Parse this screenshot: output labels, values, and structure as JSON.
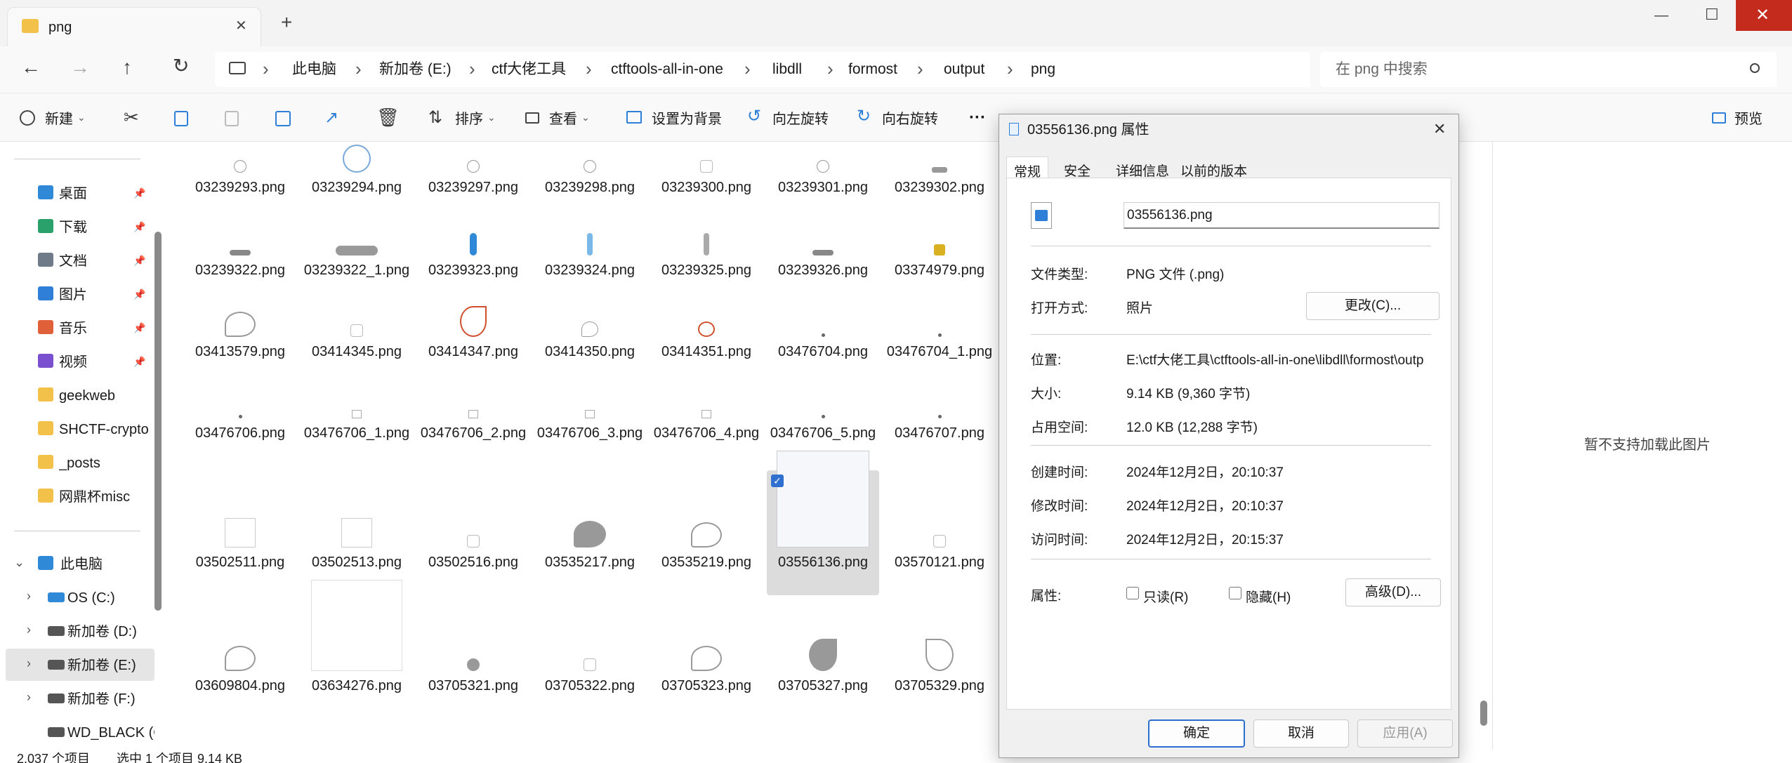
{
  "window": {
    "tab_title": "png",
    "new_tab": "+",
    "tab_close": "✕",
    "controls": {
      "minimize": "—",
      "maximize": "☐",
      "close": "✕"
    }
  },
  "nav": {
    "back": "←",
    "forward": "→",
    "up": "↑",
    "refresh": "↻",
    "breadcrumb": [
      "此电脑",
      "新加卷 (E:)",
      "ctf大佬工具",
      "ctftools-all-in-one",
      "libdll",
      "formost",
      "output",
      "png"
    ],
    "separator": "›",
    "search_placeholder": "在 png 中搜索"
  },
  "toolbar": {
    "new": "新建",
    "set_background": "设置为背景",
    "rotate_left": "向左旋转",
    "rotate_right": "向右旋转",
    "sort": "排序",
    "view": "查看",
    "more": "···",
    "preview": "预览"
  },
  "sidebar": {
    "quick": [
      {
        "label": "桌面",
        "color": "#2f89d6",
        "pinned": true
      },
      {
        "label": "下载",
        "color": "#2aa06a",
        "pinned": true
      },
      {
        "label": "文档",
        "color": "#6f7b88",
        "pinned": true
      },
      {
        "label": "图片",
        "color": "#2f7fd8",
        "pinned": true
      },
      {
        "label": "音乐",
        "color": "#e0603a",
        "pinned": true
      },
      {
        "label": "视频",
        "color": "#7a4fd0",
        "pinned": true
      },
      {
        "label": "geekweb",
        "color": "#f2c14a",
        "pinned": false
      },
      {
        "label": "SHCTF-crypto",
        "color": "#f2c14a",
        "pinned": false
      },
      {
        "label": "_posts",
        "color": "#f2c14a",
        "pinned": false
      },
      {
        "label": "网鼎杯misc",
        "color": "#f2c14a",
        "pinned": false
      }
    ],
    "pc": "此电脑",
    "drives": [
      "OS (C:)",
      "新加卷 (D:)",
      "新加卷 (E:)",
      "新加卷 (F:)",
      "WD_BLACK (G"
    ],
    "pin_icon": "📌"
  },
  "files": {
    "rows": [
      [
        "03239293.png",
        "03239294.png",
        "03239297.png",
        "03239298.png",
        "03239300.png",
        "03239301.png",
        "03239302.png"
      ],
      [
        "03239322.png",
        "03239322_1.png",
        "03239323.png",
        "03239324.png",
        "03239325.png",
        "03239326.png",
        "03374979.png"
      ],
      [
        "03413579.png",
        "03414345.png",
        "03414347.png",
        "03414350.png",
        "03414351.png",
        "03476704.png",
        "03476704_1.png"
      ],
      [
        "03476706.png",
        "03476706_1.png",
        "03476706_2.png",
        "03476706_3.png",
        "03476706_4.png",
        "03476706_5.png",
        "03476707.png"
      ],
      [
        "03502511.png",
        "03502513.png",
        "03502516.png",
        "03535217.png",
        "03535219.png",
        "03556136.png",
        "03570121.png"
      ],
      [
        "03609804.png",
        "03634276.png",
        "03705321.png",
        "03705322.png",
        "03705323.png",
        "03705327.png",
        "03705329.png"
      ]
    ],
    "selected": "03556136.png"
  },
  "preview": {
    "message": "暂不支持加载此图片"
  },
  "status": {
    "count": "2,037 个项目",
    "selected": "选中 1 个项目 9.14 KB"
  },
  "dialog": {
    "title": "03556136.png 属性",
    "close": "✕",
    "tabs": [
      "常规",
      "安全",
      "详细信息",
      "以前的版本"
    ],
    "filename": "03556136.png",
    "labels": {
      "type": "文件类型:",
      "opens_with": "打开方式:",
      "location": "位置:",
      "size": "大小:",
      "size_on_disk": "占用空间:",
      "created": "创建时间:",
      "modified": "修改时间:",
      "accessed": "访问时间:",
      "attributes": "属性:"
    },
    "values": {
      "type": "PNG 文件 (.png)",
      "opens_with": "照片",
      "location": "E:\\ctf大佬工具\\ctftools-all-in-one\\libdll\\formost\\outp",
      "size": "9.14 KB (9,360 字节)",
      "size_on_disk": "12.0 KB (12,288 字节)",
      "created": "2024年12月2日，20:10:37",
      "modified": "2024年12月2日，20:10:37",
      "accessed": "2024年12月2日，20:15:37"
    },
    "change_button": "更改(C)...",
    "readonly": "只读(R)",
    "hidden": "隐藏(H)",
    "advanced_button": "高级(D)...",
    "ok": "确定",
    "cancel": "取消",
    "apply": "应用(A)"
  }
}
